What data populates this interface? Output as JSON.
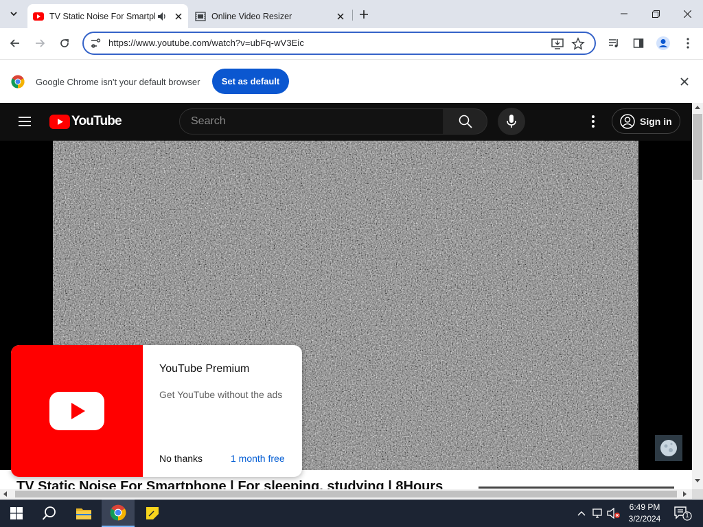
{
  "tabs": [
    {
      "title": "TV Static Noise For Smartphone | For sleeping, studying | 8Hours",
      "active": true,
      "favicon": "youtube-icon",
      "audio": "speaker-icon"
    },
    {
      "title": "Online Video Resizer",
      "active": false,
      "favicon": "video-resizer-icon"
    }
  ],
  "toolbar": {
    "url": "https://www.youtube.com/watch?v=ubFq-wV3Eic"
  },
  "infobar": {
    "message": "Google Chrome isn't your default browser",
    "button": "Set as default"
  },
  "youtube": {
    "logo_text": "YouTube",
    "search_placeholder": "Search",
    "sign_in": "Sign in",
    "video_title": "TV Static Noise For Smartphone | For sleeping, studying | 8Hours",
    "promo": {
      "title": "YouTube Premium",
      "description": "Get YouTube without the ads",
      "dismiss": "No thanks",
      "offer": "1 month free"
    }
  },
  "taskbar": {
    "time": "6:49 PM",
    "date": "3/2/2024",
    "notification_count": "1"
  },
  "colors": {
    "youtube_red": "#ff0000",
    "chrome_blue": "#0b57d0",
    "taskbar": "#1c2433"
  }
}
